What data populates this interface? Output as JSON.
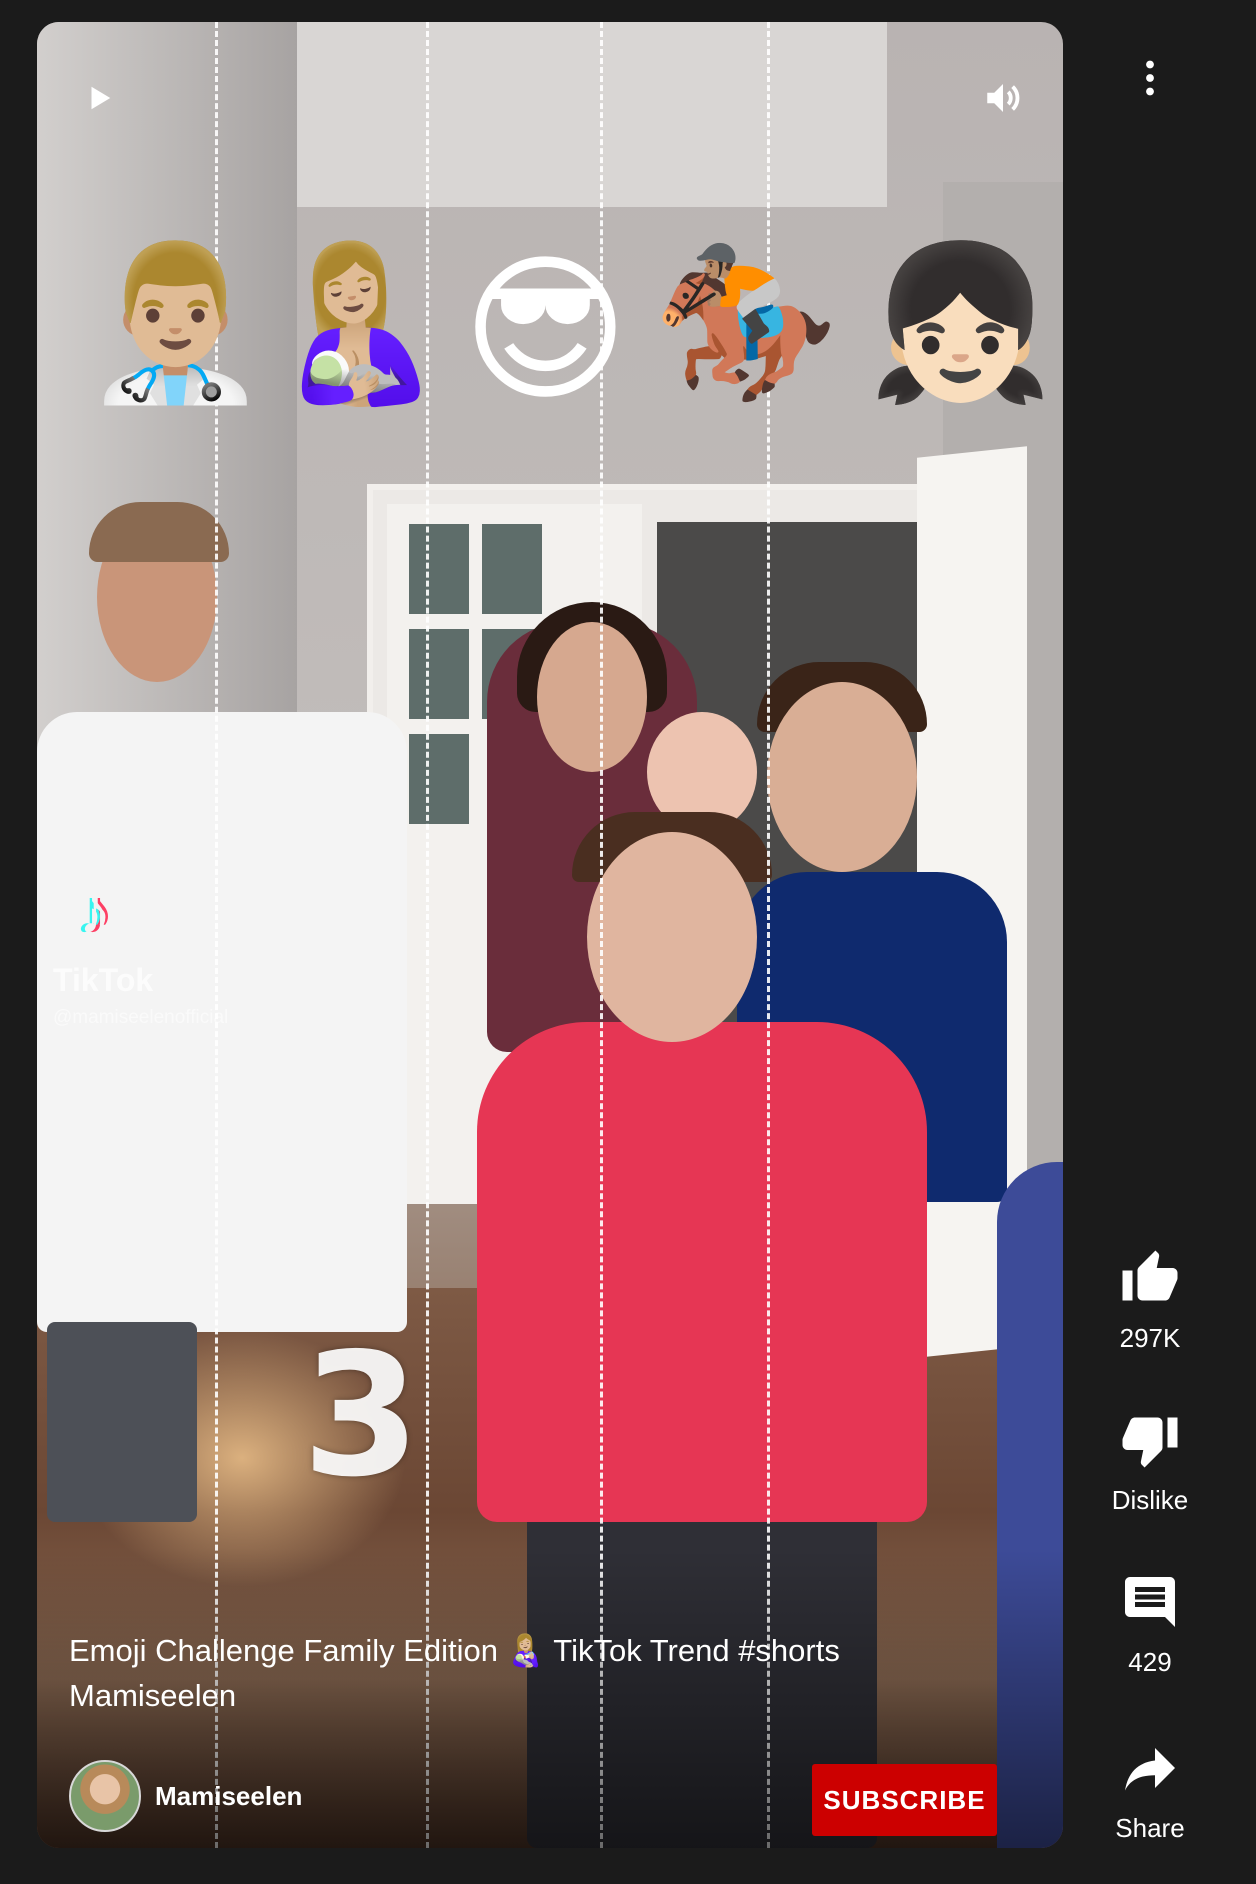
{
  "player": {
    "controls": {
      "play_icon": "play-icon",
      "volume_icon": "volume-icon",
      "more_icon": "more-vert-icon"
    },
    "overlay": {
      "emojis": [
        "👨🏼‍⚕️",
        "🤱🏼",
        "😎",
        "🏇🏽",
        "👧🏻"
      ],
      "watermark_brand": "TikTok",
      "watermark_handle": "@mamiseelenofficial",
      "countdown": "3"
    },
    "video_title": "Emoji Challenge Family Edition 👩🏼‍🍼 TikTok Trend #shorts",
    "video_subtitle": "Mamiseelen",
    "channel": {
      "name": "Mamiseelen",
      "subscribe_label": "SUBSCRIBE"
    }
  },
  "actions": {
    "like_count": "297K",
    "dislike_label": "Dislike",
    "comment_count": "429",
    "share_label": "Share"
  },
  "colors": {
    "background": "#1b1b1b",
    "subscribe": "#cc0000",
    "text": "#ffffff"
  }
}
